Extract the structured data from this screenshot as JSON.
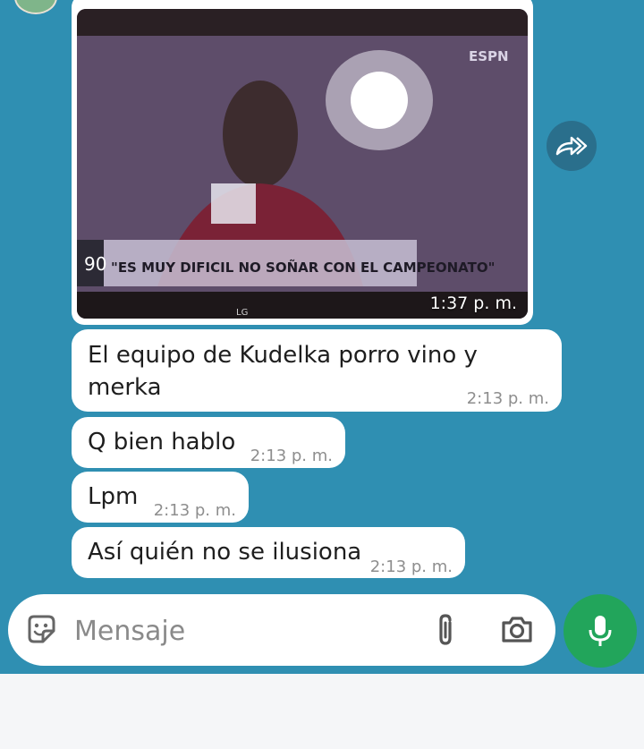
{
  "image_message": {
    "time": "1:37 p. m.",
    "tv_caption": "\"ES MUY DIFICIL NO SOÑAR CON EL CAMPEONATO\"",
    "tv_minute": "90",
    "tv_brand": "LG",
    "tv_logo": "ESPN"
  },
  "messages": [
    {
      "text": "El equipo de Kudelka porro vino y merka",
      "time": "2:13 p. m."
    },
    {
      "text": "Q bien hablo",
      "time": "2:13 p. m."
    },
    {
      "text": "Lpm",
      "time": "2:13 p. m."
    },
    {
      "text": "Así quién no se ilusiona",
      "time": "2:13 p. m."
    }
  ],
  "composer": {
    "placeholder": "Mensaje"
  },
  "icons": {
    "forward": "forward-icon",
    "sticker": "sticker-icon",
    "attach": "paperclip-icon",
    "camera": "camera-icon",
    "mic": "mic-icon"
  },
  "colors": {
    "chat_bg": "#2f8fb2",
    "mic_green": "#22a55b"
  }
}
